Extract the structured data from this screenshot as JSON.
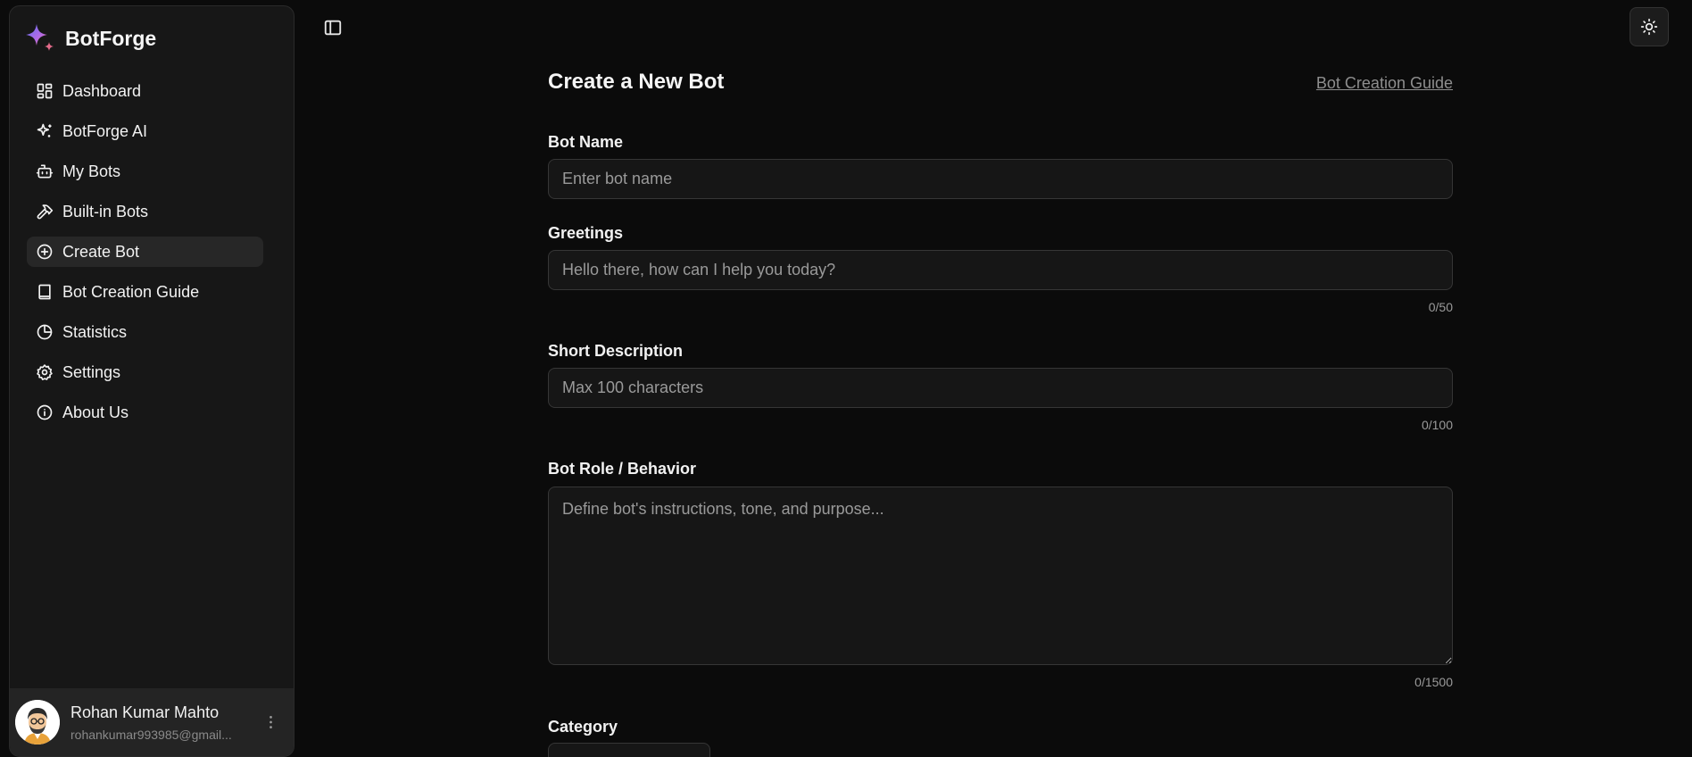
{
  "brand": {
    "name": "BotForge",
    "logo_icon": "sparkle-logo-icon"
  },
  "sidebar": {
    "items": [
      {
        "label": "Dashboard",
        "icon": "layout-dashboard-icon",
        "active": false
      },
      {
        "label": "BotForge AI",
        "icon": "sparkles-icon",
        "active": false
      },
      {
        "label": "My Bots",
        "icon": "bot-icon",
        "active": false
      },
      {
        "label": "Built-in Bots",
        "icon": "hammer-icon",
        "active": false
      },
      {
        "label": "Create Bot",
        "icon": "plus-circle-icon",
        "active": true
      },
      {
        "label": "Bot Creation Guide",
        "icon": "book-icon",
        "active": false
      },
      {
        "label": "Statistics",
        "icon": "pie-chart-icon",
        "active": false
      },
      {
        "label": "Settings",
        "icon": "gear-icon",
        "active": false
      },
      {
        "label": "About Us",
        "icon": "info-icon",
        "active": false
      }
    ]
  },
  "user": {
    "name": "Rohan Kumar Mahto",
    "email": "rohankumar993985@gmail..."
  },
  "header": {
    "toggle_icon": "panel-left-icon",
    "theme_icon": "sun-icon"
  },
  "form": {
    "title": "Create a New Bot",
    "guide_link": "Bot Creation Guide",
    "bot_name": {
      "label": "Bot Name",
      "placeholder": "Enter bot name",
      "value": ""
    },
    "greetings": {
      "label": "Greetings",
      "placeholder": "Hello there, how can I help you today?",
      "value": "",
      "counter": "0/50"
    },
    "short_description": {
      "label": "Short Description",
      "placeholder": "Max 100 characters",
      "value": "",
      "counter": "0/100"
    },
    "role": {
      "label": "Bot Role / Behavior",
      "placeholder": "Define bot's instructions, tone, and purpose...",
      "value": "",
      "counter": "0/1500"
    },
    "category": {
      "label": "Category"
    }
  },
  "colors": {
    "background": "#0b0b0b",
    "sidebar": "#171717",
    "active_item": "#272727",
    "input_bg": "#161616",
    "input_border": "#363636"
  }
}
